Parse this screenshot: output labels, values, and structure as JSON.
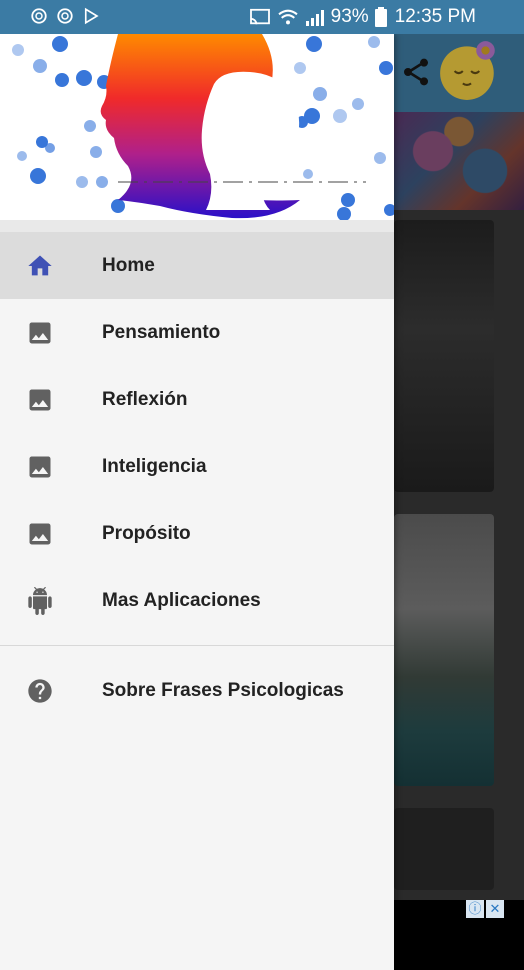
{
  "status_bar": {
    "battery_pct": "93%",
    "time": "12:35 PM"
  },
  "drawer": {
    "menu_items": [
      {
        "label": "Home",
        "icon": "home-icon",
        "active": true
      },
      {
        "label": "Pensamiento",
        "icon": "image-icon"
      },
      {
        "label": "Reflexión",
        "icon": "image-icon"
      },
      {
        "label": "Inteligencia",
        "icon": "image-icon"
      },
      {
        "label": "Propósito",
        "icon": "image-icon"
      },
      {
        "label": "Mas Aplicaciones",
        "icon": "android-icon"
      }
    ],
    "secondary_items": [
      {
        "label": "Sobre Frases Psicologicas",
        "icon": "help-icon"
      }
    ]
  },
  "colors": {
    "status_bar": "#3b7ba4",
    "active_icon": "#3f51b5",
    "icon_gray": "#616161"
  }
}
